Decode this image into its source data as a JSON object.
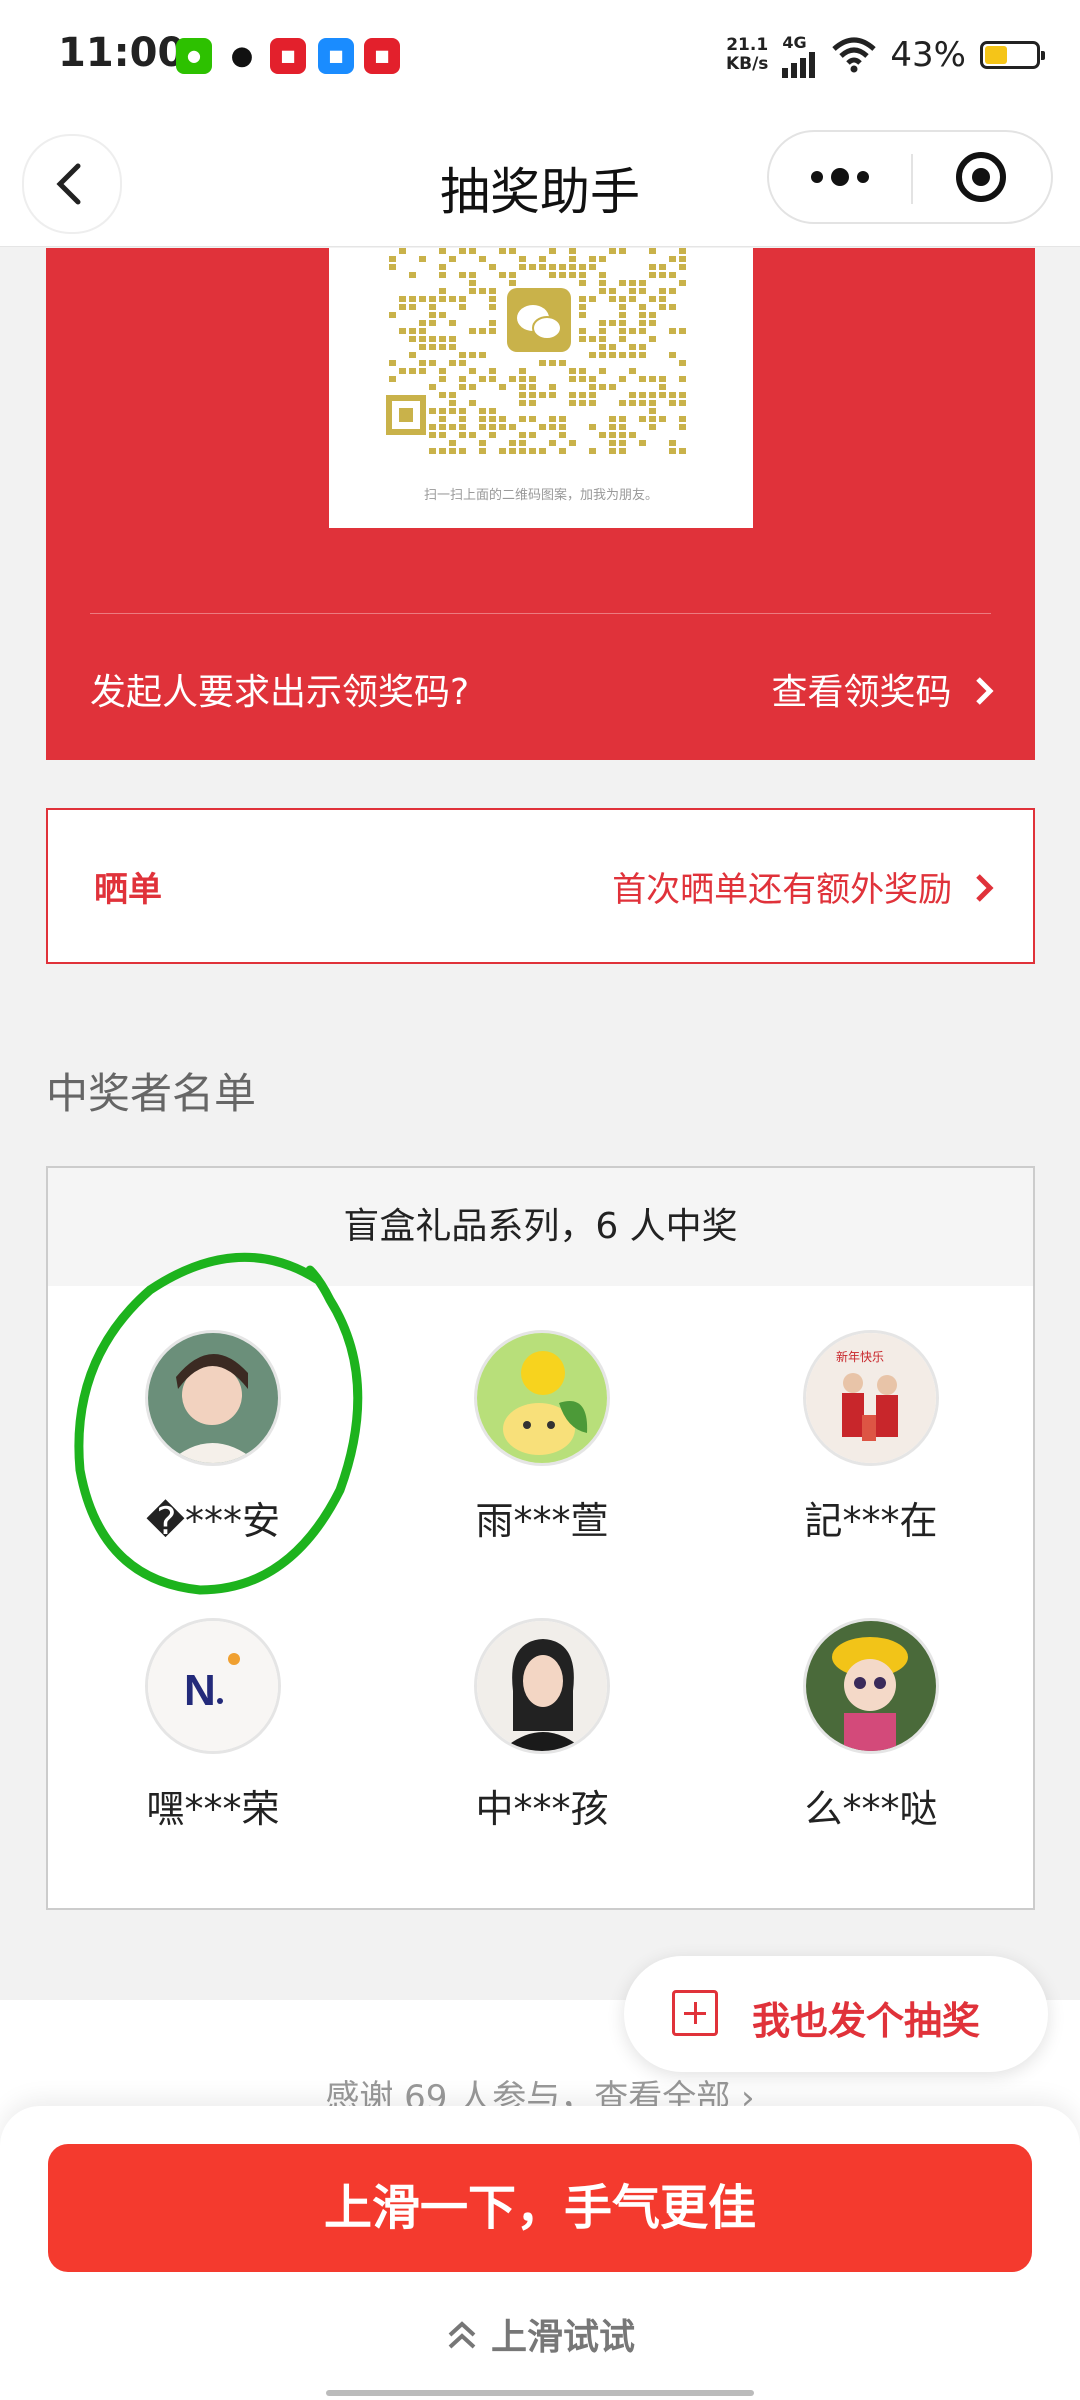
{
  "status_bar": {
    "time": "11:00",
    "net_speed_value": "21.1",
    "net_speed_unit": "KB/s",
    "network": "4G",
    "battery_percent": "43%",
    "battery_level": 0.43,
    "notification_icons": [
      "wechat-icon",
      "qq-icon",
      "app-red-icon",
      "app-blue-icon",
      "app-red-2-icon"
    ]
  },
  "nav": {
    "title": "抽奖助手"
  },
  "prize_card": {
    "qr_caption": "扫一扫上面的二维码图案，加我为朋友。",
    "claim_question": "发起人要求出示领奖码?",
    "claim_link": "查看领奖码"
  },
  "share": {
    "label": "晒单",
    "link": "首次晒单还有额外奖励"
  },
  "winners": {
    "section_title": "中奖者名单",
    "header": "盲盒礼品系列，6 人中奖",
    "list": [
      {
        "name": "�***安"
      },
      {
        "name": "雨***萱"
      },
      {
        "name": "記***在"
      },
      {
        "name": "嘿***荣"
      },
      {
        "name": "中***孩"
      },
      {
        "name": "么***哒"
      }
    ]
  },
  "fab": {
    "label": "我也发个抽奖"
  },
  "footer": {
    "thanks": "感谢 69 人参与，查看全部",
    "swipe_button": "上滑一下，手气更佳",
    "swipe_hint": "上滑试试"
  },
  "colors": {
    "accent_red": "#e0323a",
    "button_red": "#f43a2e",
    "annotation_green": "#1db31d"
  }
}
